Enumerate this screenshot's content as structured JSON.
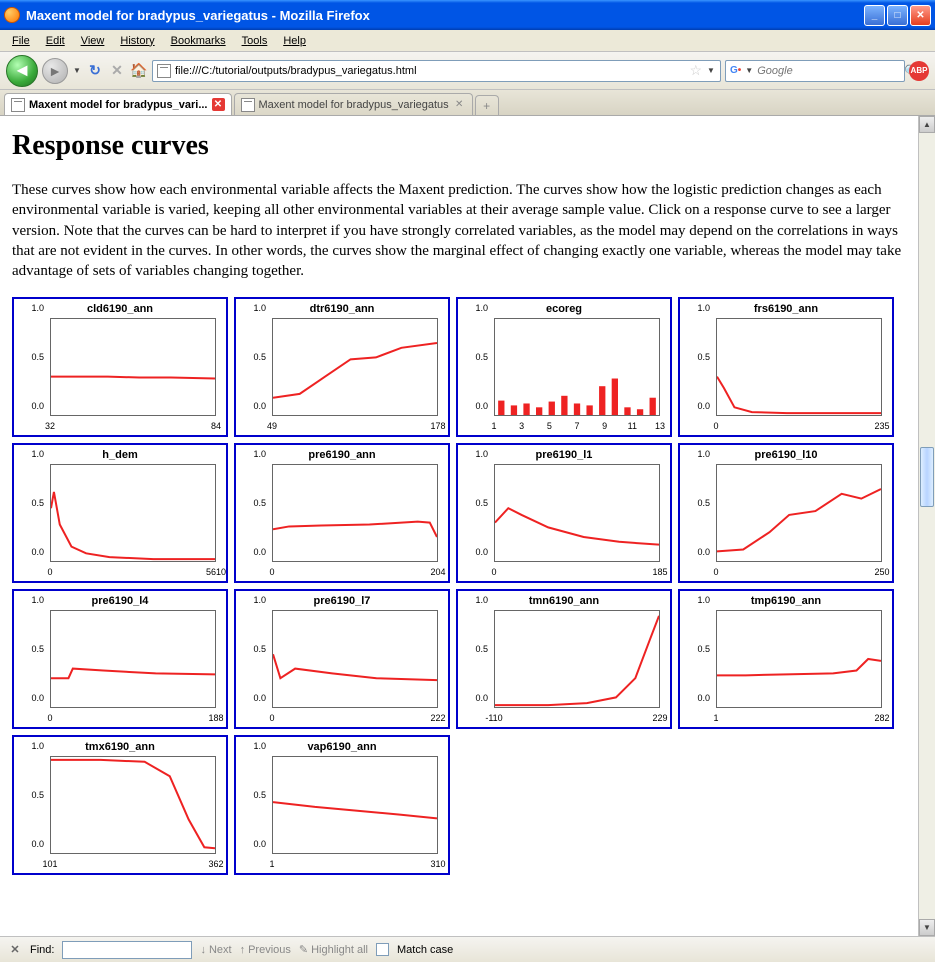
{
  "window": {
    "title": "Maxent model for bradypus_variegatus - Mozilla Firefox"
  },
  "menu": {
    "file": "File",
    "edit": "Edit",
    "view": "View",
    "history": "History",
    "bookmarks": "Bookmarks",
    "tools": "Tools",
    "help": "Help"
  },
  "toolbar": {
    "url": "file:///C:/tutorial/outputs/bradypus_variegatus.html",
    "search_placeholder": "Google"
  },
  "tabs": [
    {
      "label": "Maxent model for bradypus_vari...",
      "active": true
    },
    {
      "label": "Maxent model for bradypus_variegatus",
      "active": false
    }
  ],
  "page": {
    "heading": "Response curves",
    "description": "These curves show how each environmental variable affects the Maxent prediction. The curves show how the logistic prediction changes as each environmental variable is varied, keeping all other environmental variables at their average sample value. Click on a response curve to see a larger version. Note that the curves can be hard to interpret if you have strongly correlated variables, as the model may depend on the correlations in ways that are not evident in the curves. In other words, the curves show the marginal effect of changing exactly one variable, whereas the model may take advantage of sets of variables changing together."
  },
  "findbar": {
    "label": "Find:",
    "next": "Next",
    "previous": "Previous",
    "highlight": "Highlight all",
    "match_case": "Match case"
  },
  "chart_data": [
    {
      "type": "line",
      "title": "cld6190_ann",
      "xlabel": "",
      "ylabel": "",
      "xlim": [
        32,
        84
      ],
      "ylim": [
        0.0,
        1.0
      ],
      "y_ticks": [
        0.0,
        0.5,
        1.0
      ],
      "x_ticks": [
        32,
        84
      ],
      "x": [
        32,
        40,
        50,
        60,
        70,
        84
      ],
      "values": [
        0.4,
        0.4,
        0.4,
        0.39,
        0.39,
        0.38
      ]
    },
    {
      "type": "line",
      "title": "dtr6190_ann",
      "xlabel": "",
      "ylabel": "",
      "xlim": [
        49,
        178
      ],
      "ylim": [
        0.0,
        1.0
      ],
      "y_ticks": [
        0.0,
        0.5,
        1.0
      ],
      "x_ticks": [
        49,
        178
      ],
      "x": [
        49,
        70,
        90,
        110,
        130,
        150,
        178
      ],
      "values": [
        0.18,
        0.22,
        0.4,
        0.58,
        0.6,
        0.7,
        0.75
      ]
    },
    {
      "type": "bar",
      "title": "ecoreg",
      "xlabel": "",
      "ylabel": "",
      "xlim": [
        1,
        13
      ],
      "ylim": [
        0.0,
        1.0
      ],
      "y_ticks": [
        0.0,
        0.5,
        1.0
      ],
      "x_ticks": [
        1,
        3,
        5,
        7,
        9,
        11,
        13
      ],
      "categories": [
        1,
        2,
        3,
        4,
        5,
        6,
        7,
        8,
        9,
        10,
        11,
        12,
        13
      ],
      "values": [
        0.15,
        0.1,
        0.12,
        0.08,
        0.14,
        0.2,
        0.12,
        0.1,
        0.3,
        0.38,
        0.08,
        0.06,
        0.18
      ]
    },
    {
      "type": "line",
      "title": "frs6190_ann",
      "xlabel": "",
      "ylabel": "",
      "xlim": [
        0,
        235
      ],
      "ylim": [
        0.0,
        1.0
      ],
      "y_ticks": [
        0.0,
        0.5,
        1.0
      ],
      "x_ticks": [
        0,
        235
      ],
      "x": [
        0,
        10,
        25,
        50,
        100,
        150,
        235
      ],
      "values": [
        0.4,
        0.28,
        0.08,
        0.03,
        0.02,
        0.02,
        0.02
      ]
    },
    {
      "type": "line",
      "title": "h_dem",
      "xlabel": "",
      "ylabel": "",
      "xlim": [
        0,
        5610
      ],
      "ylim": [
        0.0,
        1.0
      ],
      "y_ticks": [
        0.0,
        0.5,
        1.0
      ],
      "x_ticks": [
        0,
        5610
      ],
      "x": [
        0,
        100,
        300,
        700,
        1200,
        2000,
        3500,
        5610
      ],
      "values": [
        0.55,
        0.72,
        0.38,
        0.15,
        0.08,
        0.04,
        0.02,
        0.02
      ]
    },
    {
      "type": "line",
      "title": "pre6190_ann",
      "xlabel": "",
      "ylabel": "",
      "xlim": [
        0,
        204
      ],
      "ylim": [
        0.0,
        1.0
      ],
      "y_ticks": [
        0.0,
        0.5,
        1.0
      ],
      "x_ticks": [
        0,
        204
      ],
      "x": [
        0,
        20,
        60,
        120,
        180,
        195,
        204
      ],
      "values": [
        0.33,
        0.36,
        0.37,
        0.38,
        0.41,
        0.4,
        0.25
      ]
    },
    {
      "type": "line",
      "title": "pre6190_l1",
      "xlabel": "",
      "ylabel": "",
      "xlim": [
        0,
        185
      ],
      "ylim": [
        0.0,
        1.0
      ],
      "y_ticks": [
        0.0,
        0.5,
        1.0
      ],
      "x_ticks": [
        0,
        185
      ],
      "x": [
        0,
        15,
        30,
        60,
        100,
        140,
        185
      ],
      "values": [
        0.4,
        0.55,
        0.48,
        0.35,
        0.25,
        0.2,
        0.17
      ]
    },
    {
      "type": "line",
      "title": "pre6190_l10",
      "xlabel": "",
      "ylabel": "",
      "xlim": [
        0,
        250
      ],
      "ylim": [
        0.0,
        1.0
      ],
      "y_ticks": [
        0.0,
        0.5,
        1.0
      ],
      "x_ticks": [
        0,
        250
      ],
      "x": [
        0,
        40,
        80,
        110,
        150,
        190,
        220,
        250
      ],
      "values": [
        0.1,
        0.12,
        0.3,
        0.48,
        0.52,
        0.7,
        0.65,
        0.75
      ]
    },
    {
      "type": "line",
      "title": "pre6190_l4",
      "xlabel": "",
      "ylabel": "",
      "xlim": [
        0,
        188
      ],
      "ylim": [
        0.0,
        1.0
      ],
      "y_ticks": [
        0.0,
        0.5,
        1.0
      ],
      "x_ticks": [
        0,
        188
      ],
      "x": [
        0,
        20,
        25,
        60,
        120,
        188
      ],
      "values": [
        0.3,
        0.3,
        0.4,
        0.38,
        0.35,
        0.34
      ]
    },
    {
      "type": "line",
      "title": "pre6190_l7",
      "xlabel": "",
      "ylabel": "",
      "xlim": [
        0,
        222
      ],
      "ylim": [
        0.0,
        1.0
      ],
      "y_ticks": [
        0.0,
        0.5,
        1.0
      ],
      "x_ticks": [
        0,
        222
      ],
      "x": [
        0,
        10,
        30,
        80,
        140,
        222
      ],
      "values": [
        0.55,
        0.3,
        0.4,
        0.35,
        0.3,
        0.28
      ]
    },
    {
      "type": "line",
      "title": "tmn6190_ann",
      "xlabel": "",
      "ylabel": "",
      "xlim": [
        -110,
        229
      ],
      "ylim": [
        0.0,
        1.0
      ],
      "y_ticks": [
        0.0,
        0.5,
        1.0
      ],
      "x_ticks": [
        -110,
        229
      ],
      "x": [
        -110,
        0,
        80,
        140,
        180,
        210,
        229
      ],
      "values": [
        0.02,
        0.02,
        0.04,
        0.1,
        0.3,
        0.7,
        0.95
      ]
    },
    {
      "type": "line",
      "title": "tmp6190_ann",
      "xlabel": "",
      "ylabel": "",
      "xlim": [
        1,
        282
      ],
      "ylim": [
        0.0,
        1.0
      ],
      "y_ticks": [
        0.0,
        0.5,
        1.0
      ],
      "x_ticks": [
        1,
        282
      ],
      "x": [
        1,
        50,
        120,
        200,
        240,
        260,
        282
      ],
      "values": [
        0.33,
        0.33,
        0.34,
        0.35,
        0.38,
        0.5,
        0.48
      ]
    },
    {
      "type": "line",
      "title": "tmx6190_ann",
      "xlabel": "",
      "ylabel": "",
      "xlim": [
        101,
        362
      ],
      "ylim": [
        0.0,
        1.0
      ],
      "y_ticks": [
        0.0,
        0.5,
        1.0
      ],
      "x_ticks": [
        101,
        362
      ],
      "x": [
        101,
        180,
        250,
        290,
        320,
        345,
        362
      ],
      "values": [
        0.97,
        0.97,
        0.95,
        0.8,
        0.35,
        0.06,
        0.05
      ]
    },
    {
      "type": "line",
      "title": "vap6190_ann",
      "xlabel": "",
      "ylabel": "",
      "xlim": [
        1,
        310
      ],
      "ylim": [
        0.0,
        1.0
      ],
      "y_ticks": [
        0.0,
        0.5,
        1.0
      ],
      "x_ticks": [
        1,
        310
      ],
      "x": [
        1,
        80,
        160,
        240,
        310
      ],
      "values": [
        0.53,
        0.48,
        0.44,
        0.4,
        0.36
      ]
    }
  ]
}
